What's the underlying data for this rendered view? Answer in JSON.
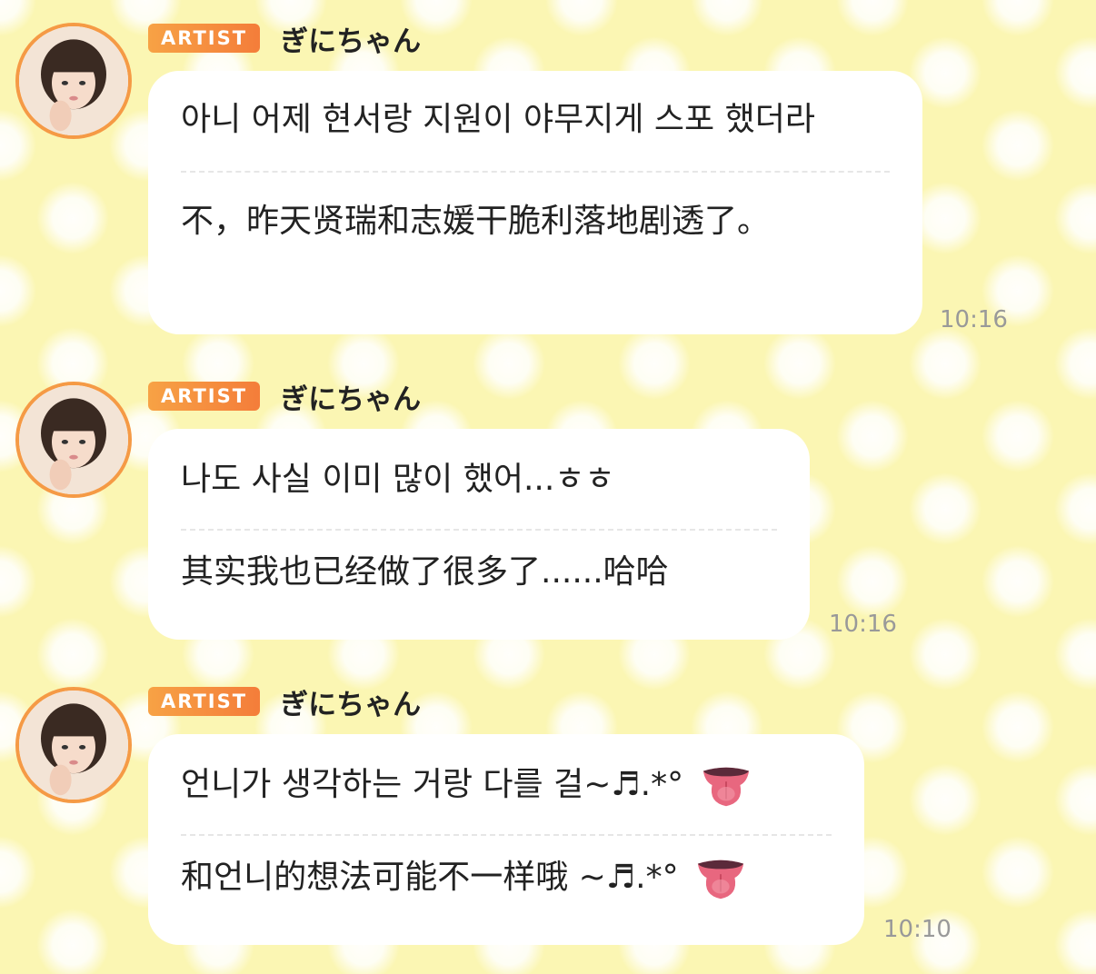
{
  "messages": [
    {
      "badge": "ARTIST",
      "username": "ぎにちゃん",
      "korean": "아니 어제 현서랑 지원이 야무지게 스포 했더라",
      "chinese": "不，昨天贤瑞和志媛干脆利落地剧透了。",
      "time": "10:16"
    },
    {
      "badge": "ARTIST",
      "username": "ぎにちゃん",
      "korean": "나도 사실 이미 많이 했어...ㅎㅎ",
      "chinese": "其实我也已经做了很多了......哈哈",
      "time": "10:16"
    },
    {
      "badge": "ARTIST",
      "username": "ぎにちゃん",
      "korean": "언니가 생각하는 거랑 다를 걸~♬.*°",
      "chinese": "和언니的想法可能不一样哦 ~♬.*°",
      "time": "10:10",
      "emoji": "tongue-emoji"
    }
  ],
  "colors": {
    "background": "#fbf6b3",
    "badge": "#f47d3a",
    "avatar_ring": "#f59a45",
    "bubble": "#ffffff",
    "time": "#999999"
  }
}
